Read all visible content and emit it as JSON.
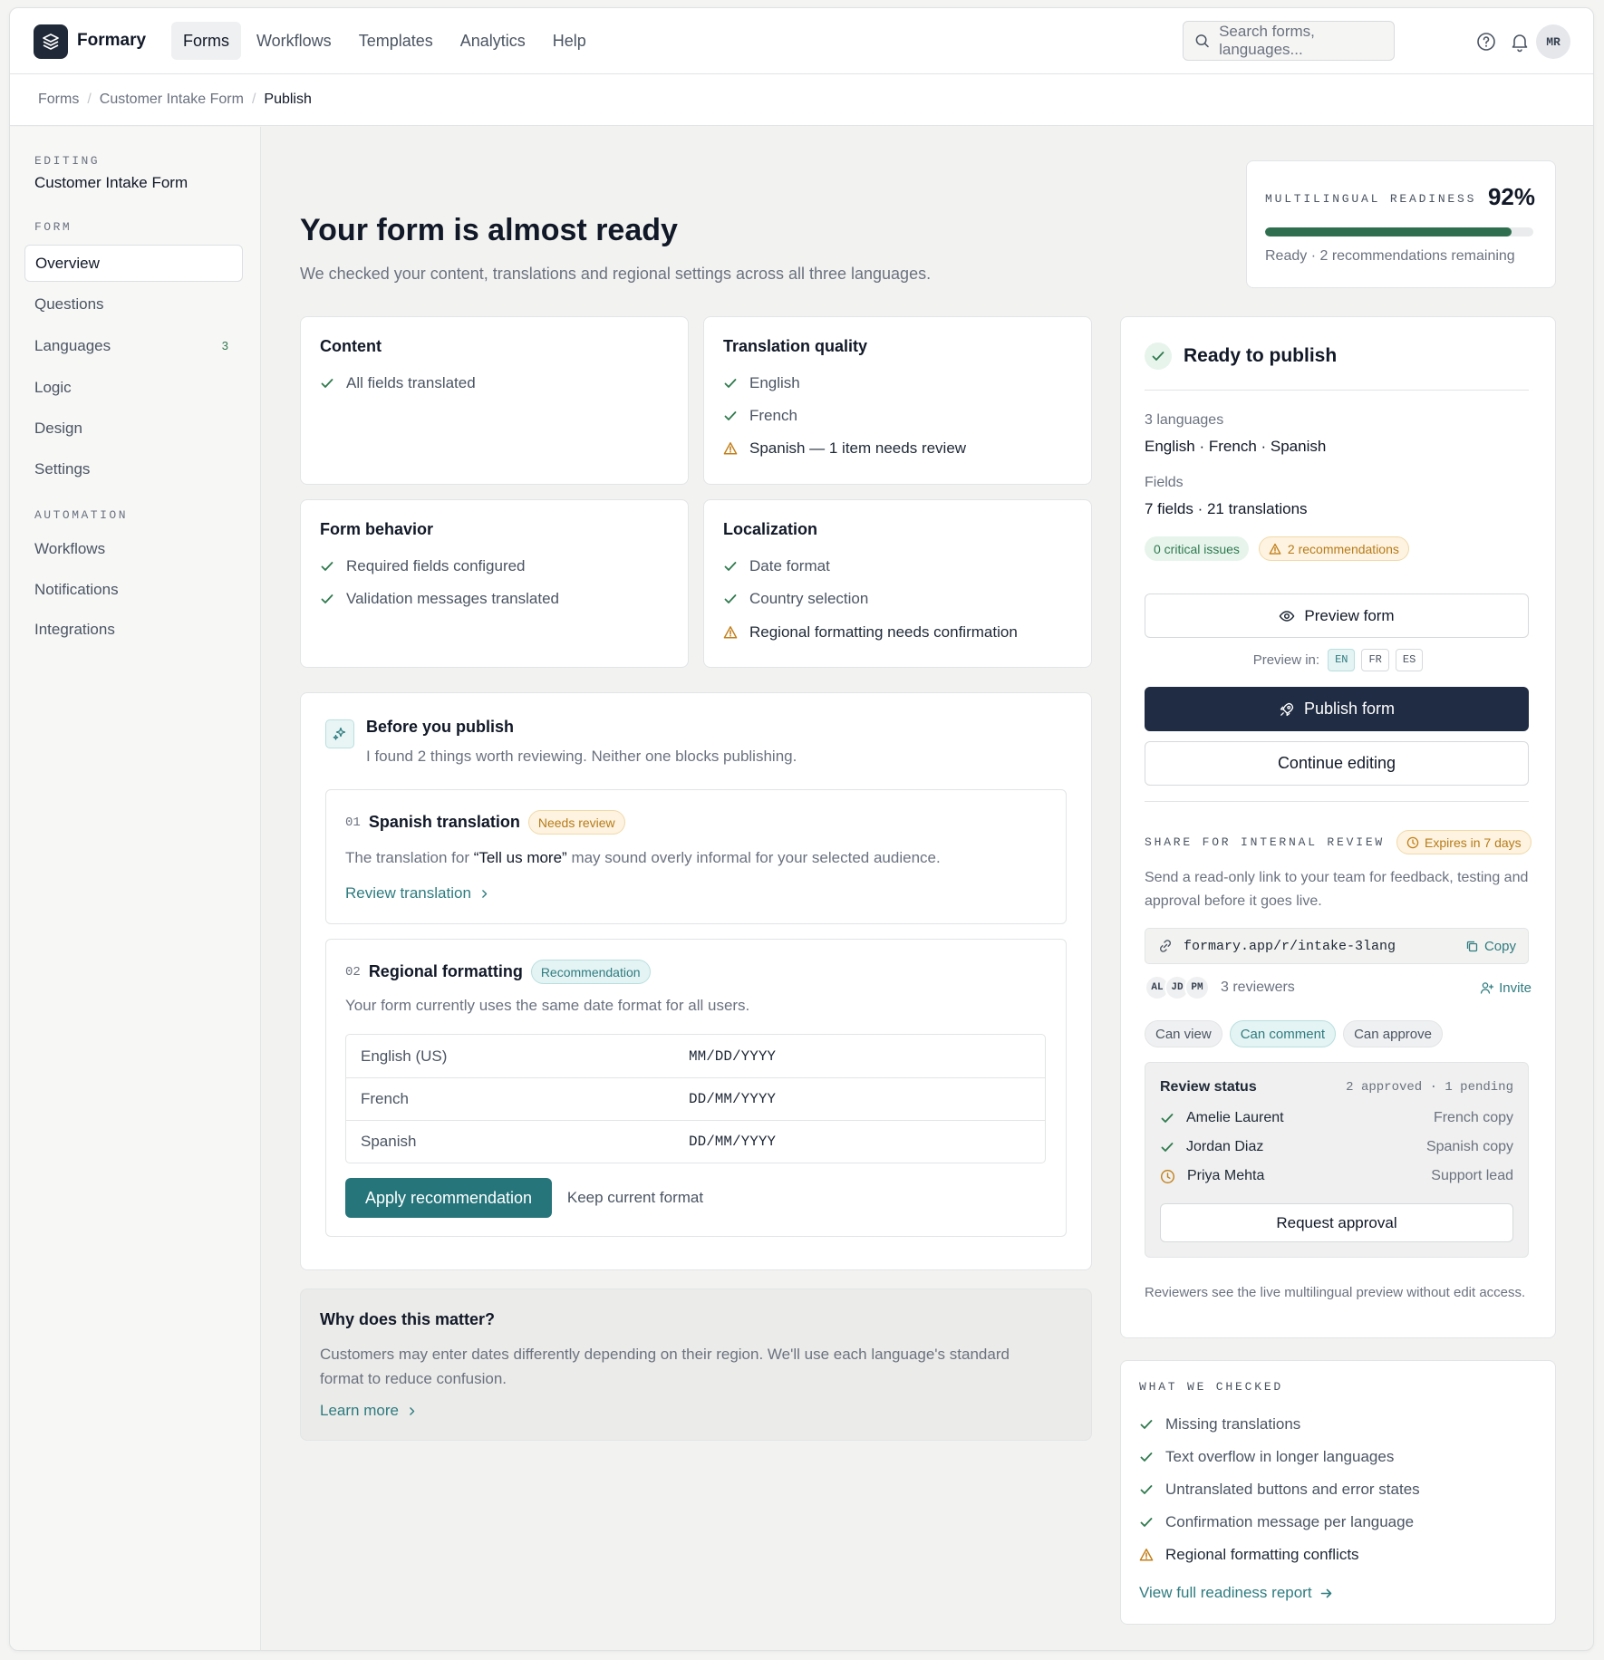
{
  "app": {
    "brand": "Formary",
    "user_initials": "MR"
  },
  "nav": [
    "Forms",
    "Workflows",
    "Templates",
    "Analytics",
    "Help"
  ],
  "search": {
    "placeholder": "Search forms, languages..."
  },
  "breadcrumb": [
    "Forms",
    "Customer Intake Form",
    "Publish"
  ],
  "sidebar": {
    "editing_label": "EDITING",
    "form_name": "Customer Intake Form",
    "form_label": "FORM",
    "form_items": [
      "Overview",
      "Questions",
      "Languages",
      "Logic",
      "Design",
      "Settings"
    ],
    "languages_count": "3",
    "automation_label": "AUTOMATION",
    "automation_items": [
      "Workflows",
      "Notifications",
      "Integrations"
    ]
  },
  "header": {
    "title": "Your form is almost ready",
    "subtitle": "We checked your content, translations and regional settings across all three languages."
  },
  "readiness": {
    "label": "MULTILINGUAL READINESS",
    "percent_text": "92%",
    "percent": 92,
    "note": "Ready · 2 recommendations remaining"
  },
  "checks": {
    "content": {
      "title": "Content",
      "items": [
        "All fields translated"
      ]
    },
    "translation": {
      "title": "Translation quality",
      "items": [
        "English",
        "French",
        "Spanish — 1 item needs review"
      ]
    },
    "behavior": {
      "title": "Form behavior",
      "items": [
        "Required fields configured",
        "Validation messages translated"
      ]
    },
    "localization": {
      "title": "Localization",
      "items": [
        "Date format",
        "Country selection",
        "Regional formatting needs confirmation"
      ]
    }
  },
  "before": {
    "title": "Before you publish",
    "subtitle": "I found 2 things worth reviewing. Neither one blocks publishing.",
    "item1": {
      "num": "01",
      "title": "Spanish translation",
      "badge": "Needs review",
      "text_before": "The translation for ",
      "quote": "“Tell us more”",
      "text_after": " may sound overly informal for your selected audience.",
      "link": "Review translation"
    },
    "item2": {
      "num": "02",
      "title": "Regional formatting",
      "badge": "Recommendation",
      "text": "Your form currently uses the same date format for all users.",
      "rows": [
        {
          "lang": "English (US)",
          "format": "MM/DD/YYYY"
        },
        {
          "lang": "French",
          "format": "DD/MM/YYYY"
        },
        {
          "lang": "Spanish",
          "format": "DD/MM/YYYY"
        }
      ],
      "apply": "Apply recommendation",
      "keep": "Keep current format"
    }
  },
  "why": {
    "title": "Why does this matter?",
    "text": "Customers may enter dates differently depending on their region. We'll use each language's standard format to reduce confusion.",
    "link": "Learn more"
  },
  "publish": {
    "title": "Ready to publish",
    "languages_label": "3 languages",
    "languages_value": "English · French · Spanish",
    "fields_label": "Fields",
    "fields_value": "7 fields · 21 translations",
    "critical": "0 critical issues",
    "recommendations": "2 recommendations",
    "preview_button": "Preview form",
    "preview_in": "Preview in:",
    "preview_langs": [
      "EN",
      "FR",
      "ES"
    ],
    "publish_button": "Publish form",
    "continue_button": "Continue editing"
  },
  "share": {
    "label": "SHARE FOR INTERNAL REVIEW",
    "expires": "Expires in 7 days",
    "text": "Send a read-only link to your team for feedback, testing and approval before it goes live.",
    "link": "formary.app/r/intake-3lang",
    "copy": "Copy",
    "reviewer_initials": [
      "AL",
      "JD",
      "PM"
    ],
    "reviewers": "3 reviewers",
    "invite": "Invite",
    "permissions": [
      "Can view",
      "Can comment",
      "Can approve"
    ],
    "status_title": "Review status",
    "status_summary": "2 approved · 1 pending",
    "status_rows": [
      {
        "name": "Amelie Laurent",
        "role": "French copy",
        "state": "approved"
      },
      {
        "name": "Jordan Diaz",
        "role": "Spanish copy",
        "state": "approved"
      },
      {
        "name": "Priya Mehta",
        "role": "Support lead",
        "state": "pending"
      }
    ],
    "request_button": "Request approval",
    "footnote": "Reviewers see the live multilingual preview without edit access."
  },
  "checked": {
    "label": "WHAT WE CHECKED",
    "items": [
      "Missing translations",
      "Text overflow in longer languages",
      "Untranslated buttons and error states",
      "Confirmation message per language",
      "Regional formatting conflicts"
    ],
    "link": "View full readiness report"
  },
  "colors": {
    "accent": "#25757b",
    "dark": "#202c43",
    "success": "#2f7a4e",
    "warning": "#c27f1a"
  }
}
